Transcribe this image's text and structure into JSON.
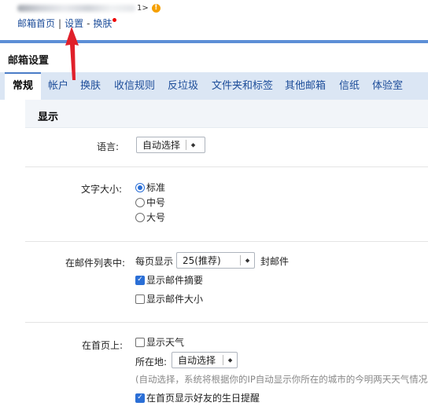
{
  "header": {
    "account_suffix": "1>",
    "warning_icon": "alert-circle-icon",
    "links": {
      "home": "邮箱首页",
      "separator": "|",
      "settings": "设置",
      "dash": "-",
      "skin": "换肤"
    }
  },
  "page_title": "邮箱设置",
  "tabs": [
    {
      "label": "常规",
      "active": true
    },
    {
      "label": "帐户"
    },
    {
      "label": "换肤"
    },
    {
      "label": "收信规则"
    },
    {
      "label": "反垃圾"
    },
    {
      "label": "文件夹和标签"
    },
    {
      "label": "其他邮箱"
    },
    {
      "label": "信纸"
    },
    {
      "label": "体验室"
    }
  ],
  "section_title": "显示",
  "language": {
    "label": "语言:",
    "value": "自动选择"
  },
  "font_size": {
    "label": "文字大小:",
    "options": [
      {
        "label": "标准",
        "selected": true
      },
      {
        "label": "中号",
        "selected": false
      },
      {
        "label": "大号",
        "selected": false
      }
    ]
  },
  "mail_list": {
    "label": "在邮件列表中:",
    "per_page_prefix": "每页显示",
    "per_page_value": "25(推荐)",
    "per_page_suffix": "封邮件",
    "show_summary": {
      "label": "显示邮件摘要",
      "checked": true
    },
    "show_size": {
      "label": "显示邮件大小",
      "checked": false
    }
  },
  "homepage": {
    "label": "在首页上:",
    "show_weather": {
      "label": "显示天气",
      "checked": false
    },
    "location_label": "所在地:",
    "location_value": "自动选择",
    "hint": "(自动选择，系统将根据你的IP自动显示你所在的城市的今明两天天气情况。)",
    "birthday": {
      "label": "在首页显示好友的生日提醒",
      "checked": true
    }
  },
  "colors": {
    "accent_blue": "#5d8fd6",
    "tab_bar": "#dbe6f4",
    "link": "#1e4e9a",
    "annotation_arrow": "#e0202a"
  }
}
